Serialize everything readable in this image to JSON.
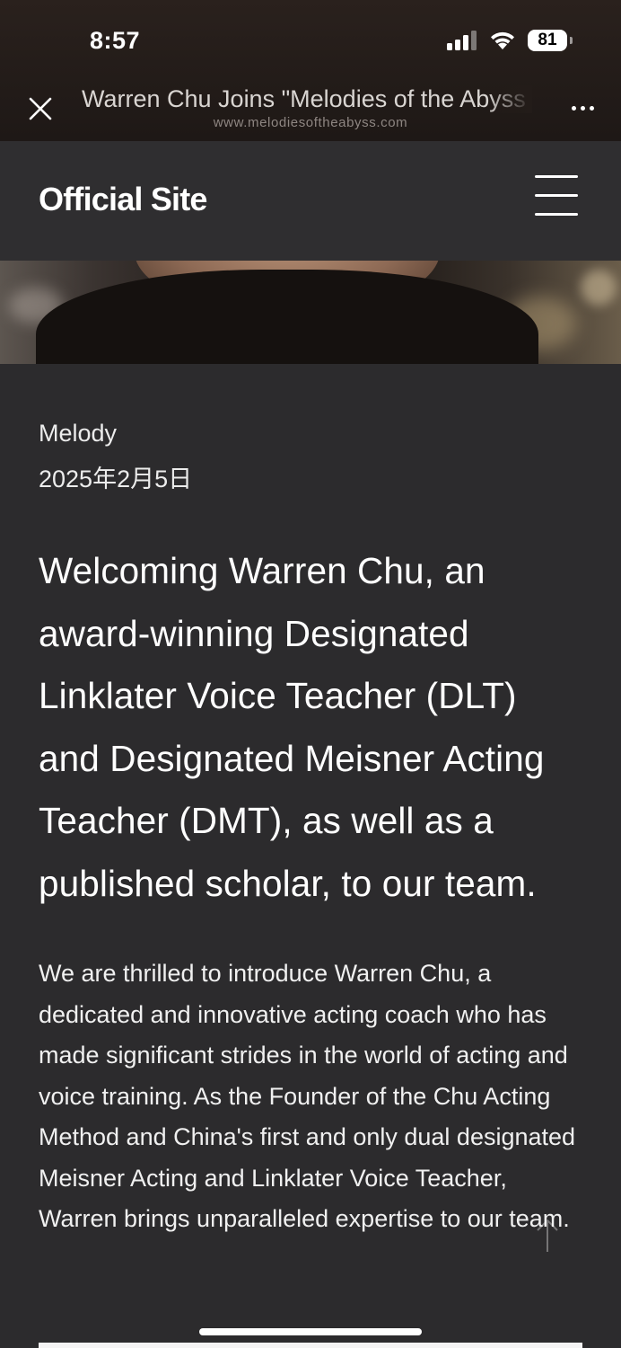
{
  "status_bar": {
    "time": "8:57",
    "battery": "81",
    "icons": [
      "signal-icon",
      "wifi-icon",
      "battery-icon"
    ]
  },
  "browser": {
    "page_title": "Warren Chu Joins \"Melodies of the Abyss",
    "url": "www.melodiesoftheabyss.com",
    "close_icon": "close-icon",
    "more_icon": "more-icon"
  },
  "site_header": {
    "logo": "Official Site",
    "menu_icon": "hamburger-menu-icon"
  },
  "article": {
    "author": "Melody",
    "date": "2025年2月5日",
    "headline": "Welcoming Warren Chu, an award-winning Designated Linklater Voice Teacher (DLT) and Designated Meisner Acting Teacher (DMT), as well as a published scholar, to our team.",
    "body": "We are thrilled to introduce Warren Chu, a dedicated and innovative acting coach who has made significant strides in the world of acting and voice training. As the Founder of the Chu Acting Method and China's first and only dual designated Meisner Acting and Linklater Voice Teacher, Warren brings unparalleled expertise to our team."
  },
  "colors": {
    "page_background": "#2c2b2d",
    "header_background": "#2f2e30",
    "text": "#f0f0f0"
  }
}
